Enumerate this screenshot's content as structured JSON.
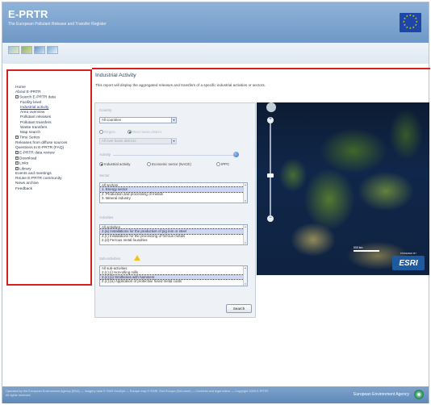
{
  "header": {
    "title": "E-PRTR",
    "subtitle": "The European Pollutant Release and Transfer Register"
  },
  "sidebar": {
    "items": [
      {
        "label": "Home",
        "level": 0,
        "toggle": ""
      },
      {
        "label": "About E-PRTR",
        "level": 0,
        "toggle": ""
      },
      {
        "label": "Search E-PRTR data",
        "level": 0,
        "toggle": "−"
      },
      {
        "label": "Facility level",
        "level": 1,
        "toggle": ""
      },
      {
        "label": "Industrial activity",
        "level": 1,
        "toggle": "",
        "active": true
      },
      {
        "label": "Area overview",
        "level": 1,
        "toggle": ""
      },
      {
        "label": "Pollutant releases",
        "level": 1,
        "toggle": ""
      },
      {
        "label": "Pollutant transfers",
        "level": 1,
        "toggle": ""
      },
      {
        "label": "Waste transfers",
        "level": 1,
        "toggle": ""
      },
      {
        "label": "Map search",
        "level": 1,
        "toggle": ""
      },
      {
        "label": "Time Series",
        "level": 0,
        "toggle": "+"
      },
      {
        "label": "Releases from diffuse sources",
        "level": 0,
        "toggle": ""
      },
      {
        "label": "Questions to E-PRTR (FAQ)",
        "level": 0,
        "toggle": ""
      },
      {
        "label": "E-PRTR data review",
        "level": 0,
        "toggle": "+"
      },
      {
        "label": "Download",
        "level": 0,
        "toggle": "+"
      },
      {
        "label": "Links",
        "level": 0,
        "toggle": "+"
      },
      {
        "label": "Library",
        "level": 0,
        "toggle": "+"
      },
      {
        "label": "Events and meetings",
        "level": 0,
        "toggle": ""
      },
      {
        "label": "Reuse E-PRTR community",
        "level": 0,
        "toggle": ""
      },
      {
        "label": "News archive",
        "level": 0,
        "toggle": ""
      },
      {
        "label": "Feedback",
        "level": 0,
        "toggle": ""
      }
    ]
  },
  "content": {
    "heading": "Industrial Activity",
    "description": "This report will display the aggregated releases and transfers of a specific industrial activities or sectors."
  },
  "search_panel": {
    "country_label": "Country",
    "country_value": "All countries",
    "region_radio": "Region",
    "river_basin_radio": "River basin district",
    "river_basin_value": "All river basin districts",
    "activity_label": "Activity",
    "activity_radios": [
      "Industrial activity",
      "Economic sector (NACE)",
      "IPPC"
    ],
    "sector_label": "Sector",
    "sectors": [
      "All sectors",
      "1. Energy sector",
      "2. Production and processing of metals",
      "3. Mineral industry"
    ],
    "activities_label": "Activities",
    "activities": [
      "All activities",
      "2.(a) Installations for the production of pig iron or steel",
      "2.(c) Installations for the processing of ferrous metals",
      "2.(d) Ferrous metal foundries"
    ],
    "sub_activities_label": "Sub-activities",
    "sub_activities": [
      "All sub-activities",
      "2.(c).(i) Hot-rolling mills",
      "2.(c).(ii) Smitheries with hammers",
      "2.(c).(iii) Application of protective fused metal coats"
    ],
    "search_button": "Search"
  },
  "map": {
    "brand": "ESRI",
    "powered_by": "POWERED BY",
    "scale_label": "500 km"
  },
  "footer": {
    "legal": "Operated by the European Environment Agency (EEA) — Imagery data © 2009 GeoEye — Europe map © ESRI, Esri Europe (DeLorme) — Contents and legal notice — Copyright 2009 E-PRTR. All rights reserved.",
    "agency": "European Environment Agency"
  },
  "colors": {
    "header_blue": "#7aa3cf",
    "highlight_red": "#d52020",
    "selected_option": "#cdd6f6"
  }
}
